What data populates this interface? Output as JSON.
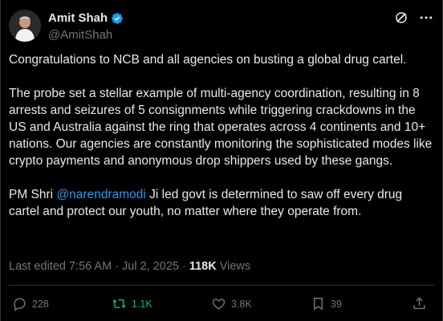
{
  "post": {
    "author_name": "Amit Shah",
    "author_handle": "@AmitShah",
    "paragraph1": "Congratulations to NCB and all agencies on busting a global drug cartel.",
    "paragraph2": "The probe set a stellar example of multi-agency coordination, resulting in 8 arrests and seizures of 5 consignments while triggering crackdowns in the US and Australia against the ring that operates across 4 continents and 10+ nations. Our agencies are constantly monitoring the sophisticated modes like crypto payments and anonymous drop shippers used by these gangs.",
    "paragraph3_prefix": "PM Shri ",
    "mention": "@narendramodi",
    "paragraph3_suffix": " Ji led govt is determined to saw off every drug cartel and protect our youth, no matter where they operate from.",
    "edited_time": "Last edited 7:56 AM",
    "separator": "·",
    "date": "Jul 2, 2025",
    "views_count": "118K",
    "views_label": "Views"
  },
  "actions": {
    "replies": "228",
    "reposts": "1.1K",
    "likes": "3.8K",
    "bookmarks": "39"
  },
  "icons": {
    "verified": "verified-badge-icon",
    "grok": "grok-icon",
    "more": "more-options-icon",
    "reply": "reply-icon",
    "repost": "repost-icon",
    "like": "heart-icon",
    "bookmark": "bookmark-icon",
    "share": "share-icon"
  },
  "colors": {
    "background": "#000000",
    "text": "#e7e9ea",
    "muted": "#71767b",
    "link": "#1d9bf0",
    "repost_active": "#00ba7c",
    "verified": "#1d9bf0"
  }
}
